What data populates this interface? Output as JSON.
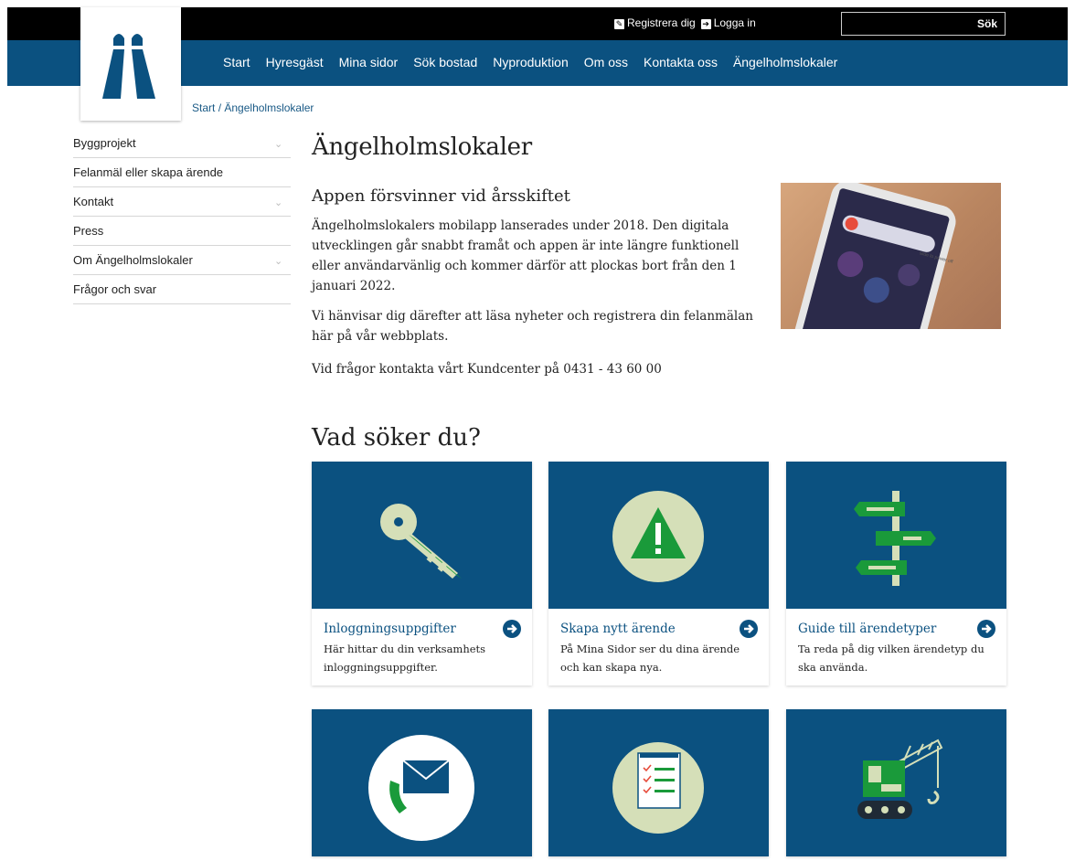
{
  "topbar": {
    "register_label": "Registrera dig",
    "login_label": "Logga in",
    "search_button": "Sök",
    "search_placeholder": ""
  },
  "nav": {
    "items": [
      "Start",
      "Hyresgäst",
      "Mina sidor",
      "Sök bostad",
      "Nyproduktion",
      "Om oss",
      "Kontakta oss",
      "Ängelholmslokaler"
    ]
  },
  "breadcrumb": {
    "start": "Start",
    "separator": "/",
    "current": "Ängelholmslokaler"
  },
  "sidebar": {
    "items": [
      {
        "label": "Byggprojekt",
        "expandable": true
      },
      {
        "label": "Felanmäl eller skapa ärende",
        "expandable": false
      },
      {
        "label": "Kontakt",
        "expandable": true
      },
      {
        "label": "Press",
        "expandable": false
      },
      {
        "label": "Om Ängelholmslokaler",
        "expandable": true
      },
      {
        "label": "Frågor och svar",
        "expandable": false
      }
    ]
  },
  "main": {
    "title": "Ängelholmslokaler",
    "article_heading": "Appen försvinner vid årsskiftet",
    "paragraphs": [
      "Ängelholmslokalers mobilapp lanserades under 2018. Den digitala utvecklingen går snabbt framåt och appen är inte längre funktionell eller användarvänlig och kommer därför att plockas bort från den 1 januari 2022.",
      "Vi hänvisar dig därefter att läsa nyheter och registrera din felanmälan här på vår webbplats.",
      "Vid frågor kontakta vårt Kundcenter på 0431 - 43 60 00"
    ],
    "phone_screen_text": "slide to power off",
    "section_heading": "Vad söker du?"
  },
  "cards": [
    {
      "title": "Inloggningsuppgifter",
      "desc": "Här hittar du din verksamhets inloggningsuppgifter.",
      "icon": "key-icon"
    },
    {
      "title": "Skapa nytt ärende",
      "desc": "På Mina Sidor ser du dina ärende och kan skapa nya.",
      "icon": "warning-icon"
    },
    {
      "title": "Guide till ärendetyper",
      "desc": "Ta reda på dig vilken ärendetyp du ska använda.",
      "icon": "signpost-icon"
    },
    {
      "title": "",
      "desc": "",
      "icon": "phone-mail-icon"
    },
    {
      "title": "",
      "desc": "",
      "icon": "checklist-icon"
    },
    {
      "title": "",
      "desc": "",
      "icon": "crane-icon"
    }
  ],
  "colors": {
    "brand": "#0b5180",
    "accent_green": "#1a9a3a",
    "icon_bg": "#d5dfb8"
  }
}
